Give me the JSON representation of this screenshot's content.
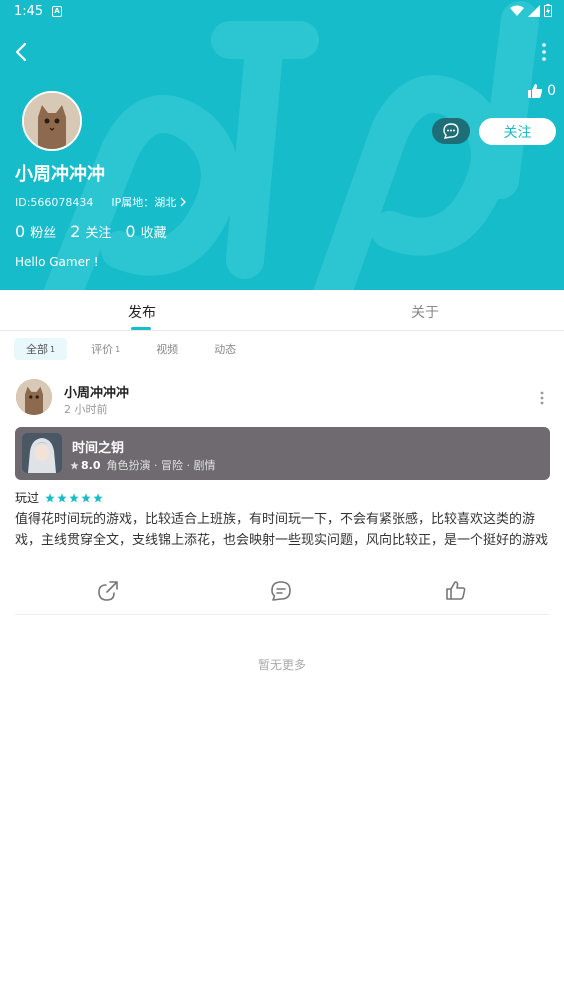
{
  "status_bar": {
    "time": "1:45",
    "notification_icon": "A"
  },
  "header": {
    "like_count": "0",
    "follow_label": "关注",
    "username": "小周冲冲冲",
    "id_text": "ID:566078434",
    "ip_text": "IP属地：湖北",
    "stats": [
      {
        "num": "0",
        "label": "粉丝"
      },
      {
        "num": "2",
        "label": "关注"
      },
      {
        "num": "0",
        "label": "收藏"
      }
    ],
    "bio": "Hello Gamer !"
  },
  "tabs": {
    "publish": "发布",
    "about": "关于"
  },
  "filters": [
    {
      "label": "全部",
      "count": "1"
    },
    {
      "label": "评价",
      "count": "1"
    },
    {
      "label": "视频",
      "count": ""
    },
    {
      "label": "动态",
      "count": ""
    }
  ],
  "post": {
    "author": "小周冲冲冲",
    "time": "2 小时前",
    "game": {
      "title": "时间之钥",
      "score": "8.0",
      "tags": "角色扮演 · 冒险 · 剧情"
    },
    "played_label": "玩过",
    "rating": 5,
    "review": "值得花时间玩的游戏，比较适合上班族，有时间玩一下，不会有紧张感，比较喜欢这类的游戏，主线贯穿全文，支线锦上添花，也会映射一些现实问题，风向比较正，是一个挺好的游戏"
  },
  "footer": {
    "no_more": "暂无更多"
  },
  "colors": {
    "accent": "#17bccb",
    "card": "#6f6a70",
    "star": "#17bccb"
  }
}
